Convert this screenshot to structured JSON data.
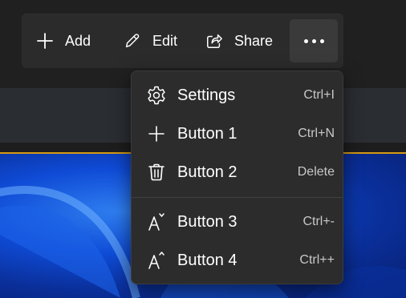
{
  "command_bar": {
    "add_label": "Add",
    "edit_label": "Edit",
    "share_label": "Share",
    "more_icon": "more-horizontal-icon"
  },
  "menu": {
    "items": [
      {
        "label": "Settings",
        "shortcut": "Ctrl+I",
        "icon": "gear-icon"
      },
      {
        "label": "Button 1",
        "shortcut": "Ctrl+N",
        "icon": "plus-icon"
      },
      {
        "label": "Button 2",
        "shortcut": "Delete",
        "icon": "trash-icon"
      },
      {
        "label": "Button 3",
        "shortcut": "Ctrl+-",
        "icon": "font-decrease-icon"
      },
      {
        "label": "Button 4",
        "shortcut": "Ctrl++",
        "icon": "font-increase-icon"
      }
    ]
  },
  "colors": {
    "background": "#202020",
    "command_bar": "#2b2b2b",
    "menu_background": "#2c2c2c",
    "accent_line": "#d59a12",
    "wallpaper_blue": "#0f4bd6",
    "shortcut_text": "#c8c8c8"
  }
}
